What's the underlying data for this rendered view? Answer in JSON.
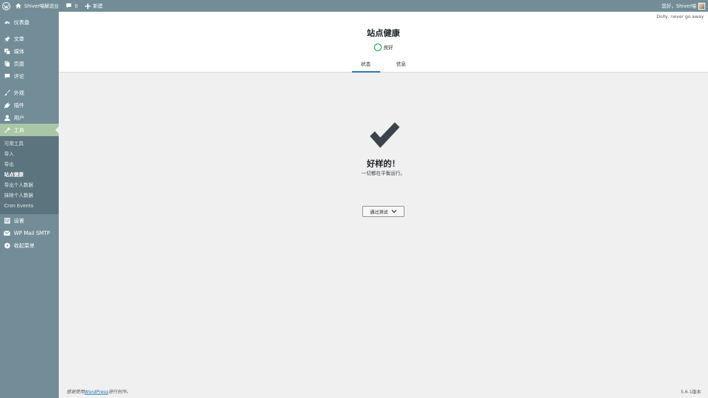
{
  "adminbar": {
    "site_name": "Shiver喵解说业",
    "comments_count": "0",
    "new_label": "新建",
    "greeting": "您好，Shiver喵"
  },
  "menu": {
    "dashboard": "仪表盘",
    "posts": "文章",
    "media": "媒体",
    "pages": "页面",
    "comments": "评论",
    "appearance": "外观",
    "plugins": "插件",
    "users": "用户",
    "tools": "工具",
    "tools_sub": [
      "可用工具",
      "导入",
      "导出",
      "站点健康",
      "导出个人数据",
      "抹除个人数据",
      "Cron Events"
    ],
    "settings": "设置",
    "wp_mail_smtp": "WP Mail SMTP",
    "collapse": "收起菜单"
  },
  "dolly": "Dolly, never go away",
  "health": {
    "title": "站点健康",
    "status": "良好",
    "tabs": [
      "状态",
      "信息"
    ],
    "result_title": "好样的！",
    "result_sub": "一切都在平衡运行。",
    "passed_button": "通过测试"
  },
  "footer": {
    "thanks_prefix": "感谢使用",
    "thanks_link": "WordPress",
    "thanks_suffix": "进行创作。",
    "version": "5.6.1版本"
  },
  "colors": {
    "sidebar": "#728d98",
    "active_menu": "#a9c7a6",
    "accent": "#2271b1",
    "good": "#00a32a"
  }
}
